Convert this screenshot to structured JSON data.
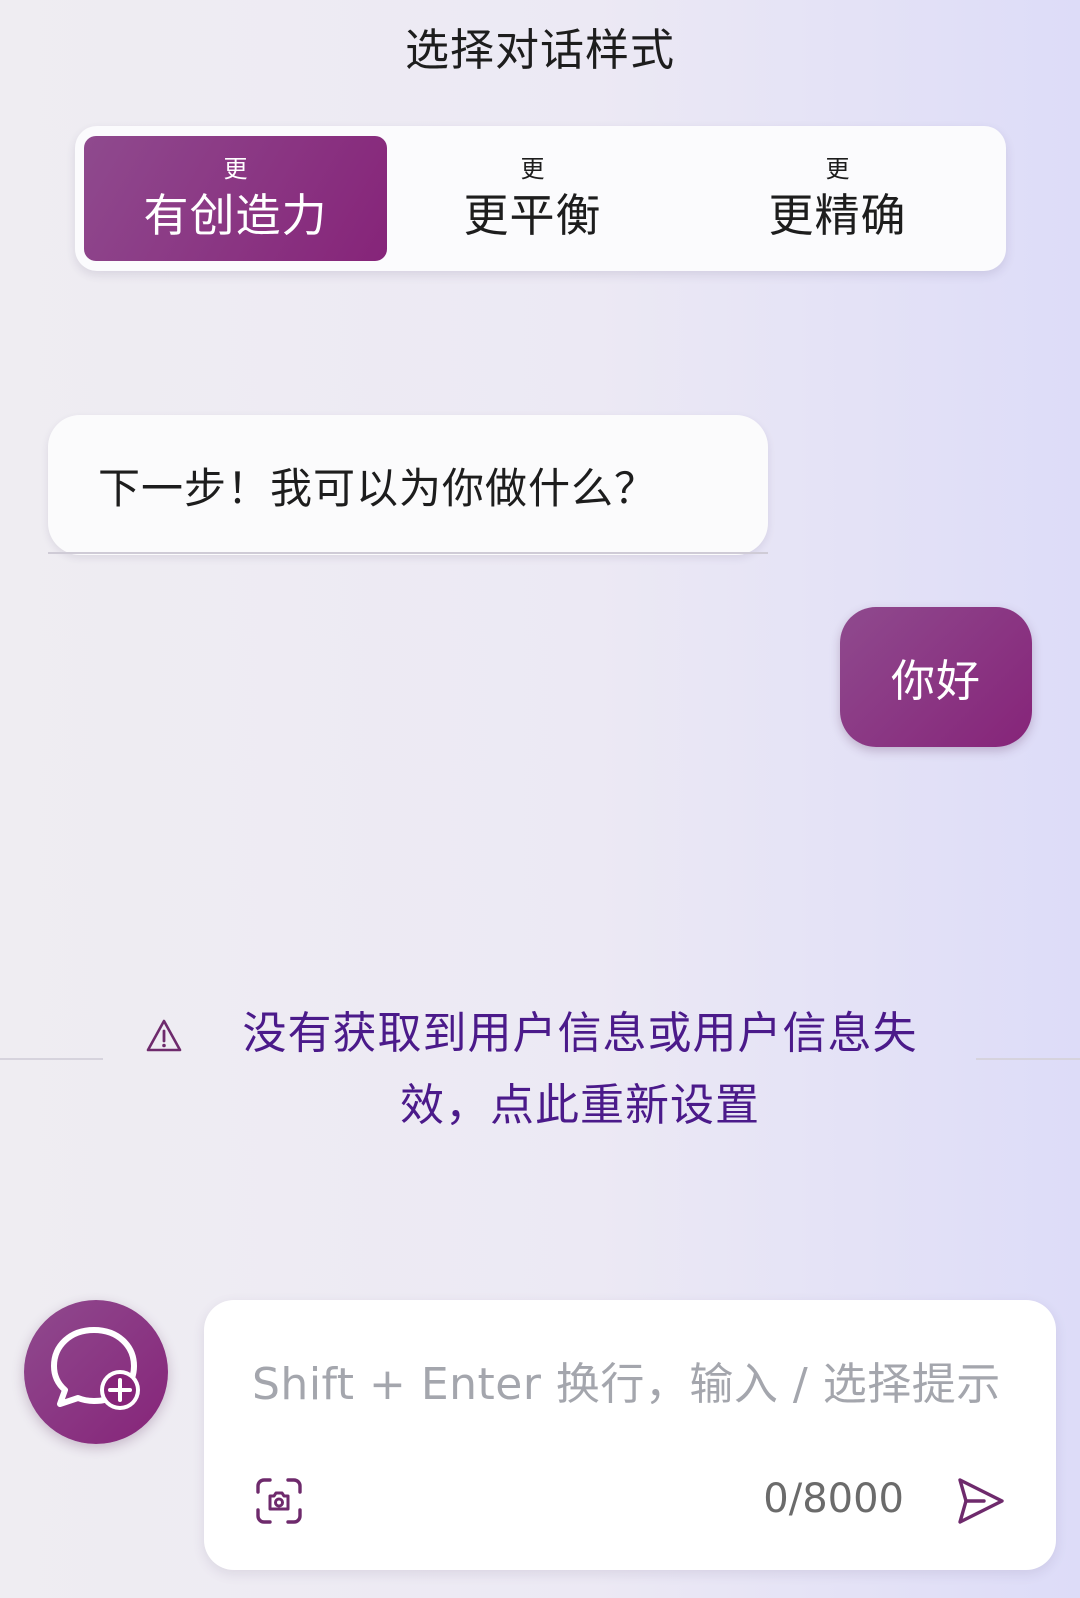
{
  "header": {
    "title": "选择对话样式"
  },
  "tones": [
    {
      "small": "更",
      "label": "有创造力",
      "active": true
    },
    {
      "small": "更",
      "label": "更平衡",
      "active": false
    },
    {
      "small": "更",
      "label": "更精确",
      "active": false
    }
  ],
  "chat": {
    "bot_message": "下一步！我可以为你做什么？",
    "user_message": "你好"
  },
  "notice": {
    "text": "没有获取到用户信息或用户信息失效，点此重新设置",
    "icon": "warning-icon"
  },
  "composer": {
    "new_chat_icon": "new-chat-icon",
    "placeholder": "Shift + Enter 换行，输入 / 选择提示",
    "counter": "0/8000",
    "scan_icon": "scan-icon",
    "send_icon": "send-icon"
  },
  "colors": {
    "accent": "#862479",
    "accent_light": "#8f4a8e",
    "notice_text": "#4b1a8a",
    "background_left": "#efedf2",
    "background_right": "#dddcf8"
  }
}
